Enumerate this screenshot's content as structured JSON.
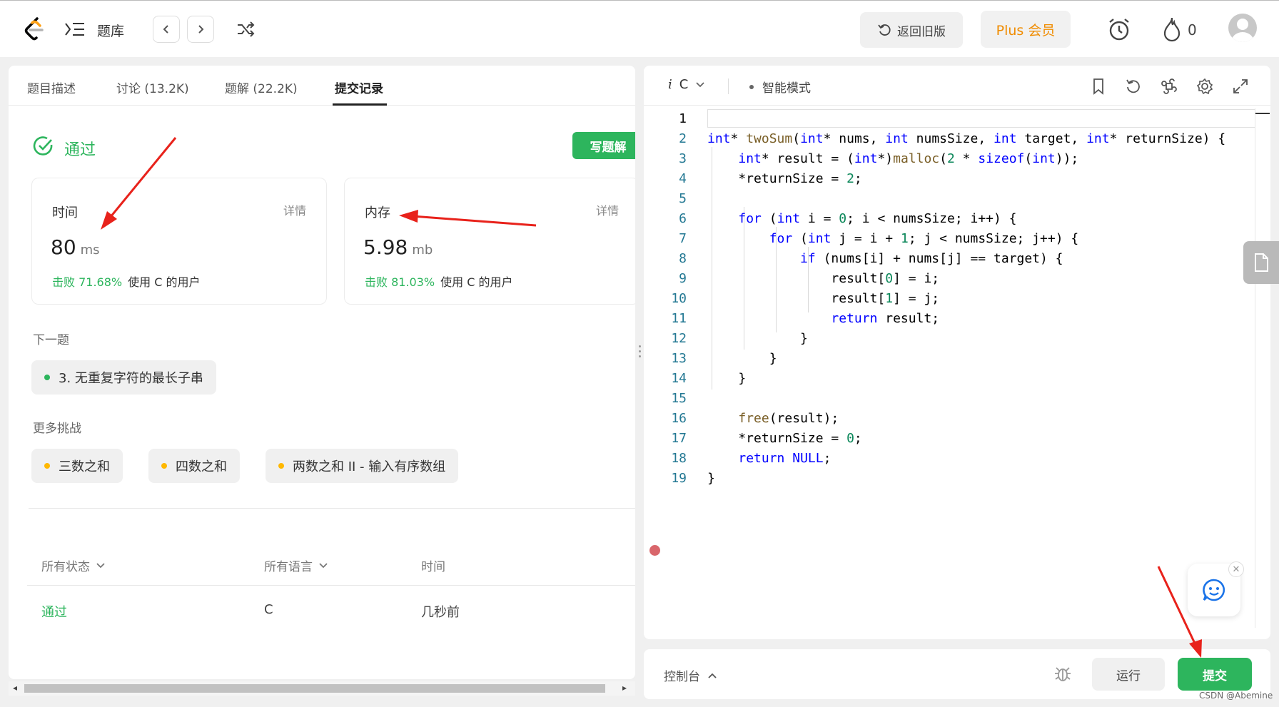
{
  "nav": {
    "title": "题库",
    "old_version": "返回旧版",
    "plus": "Plus 会员",
    "streak": "0"
  },
  "tabs": [
    "题目描述",
    "讨论 (13.2K)",
    "题解 (22.2K)",
    "提交记录"
  ],
  "result": {
    "status": "通过",
    "write_solution": "写题解",
    "time_card": {
      "label": "时间",
      "detail": "详情",
      "value": "80",
      "unit": "ms",
      "beat_label": "击败",
      "beat_pct": "71.68%",
      "beat_rest": "使用 C 的用户"
    },
    "mem_card": {
      "label": "内存",
      "detail": "详情",
      "value": "5.98",
      "unit": "mb",
      "beat_label": "击败",
      "beat_pct": "81.03%",
      "beat_rest": "使用 C 的用户"
    }
  },
  "next": {
    "title": "下一题",
    "item": "3. 无重复字符的最长子串",
    "dot_color": "#2db55d"
  },
  "more": {
    "title": "更多挑战",
    "items": [
      "三数之和",
      "四数之和",
      "两数之和 II - 输入有序数组"
    ],
    "dot_color": "#ffb800"
  },
  "table": {
    "headers": [
      "所有状态",
      "所有语言",
      "时间"
    ],
    "row": [
      "通过",
      "C",
      "几秒前"
    ]
  },
  "editor": {
    "lang_prefix": "i",
    "lang": "C",
    "mode": "智能模式",
    "line_numbers": [
      "1",
      "2",
      "3",
      "4",
      "5",
      "6",
      "7",
      "8",
      "9",
      "10",
      "11",
      "12",
      "13",
      "14",
      "15",
      "16",
      "17",
      "18",
      "19"
    ]
  },
  "console": {
    "label": "控制台",
    "run": "运行",
    "submit": "提交"
  },
  "watermark": "CSDN @Abemine",
  "colors": {
    "accent_green": "#2db55d",
    "plus_orange": "#f08c00",
    "annotation_red": "#e8221b"
  }
}
